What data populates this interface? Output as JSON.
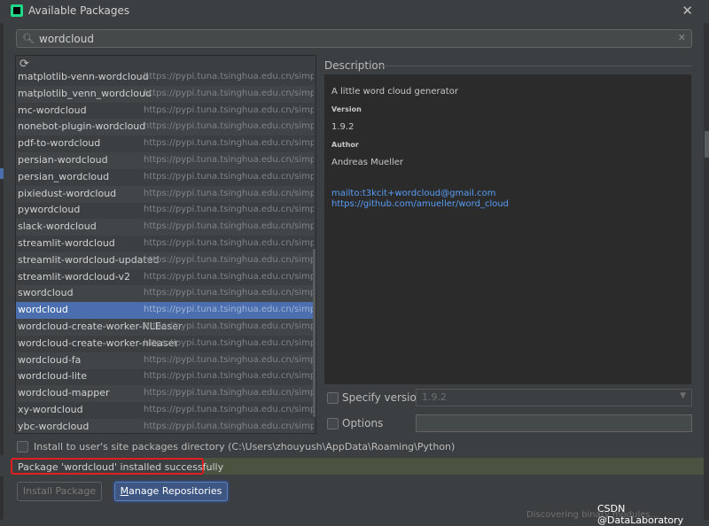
{
  "window": {
    "title": "Available Packages"
  },
  "search": {
    "value": "wordcloud"
  },
  "packages": [
    {
      "name": "matplotlib-venn-wordcloud",
      "repo": "https://pypi.tuna.tsinghua.edu.cn/simple/"
    },
    {
      "name": "matplotlib_venn_wordcloud",
      "repo": "https://pypi.tuna.tsinghua.edu.cn/simple/"
    },
    {
      "name": "mc-wordcloud",
      "repo": "https://pypi.tuna.tsinghua.edu.cn/simple/"
    },
    {
      "name": "nonebot-plugin-wordcloud",
      "repo": "https://pypi.tuna.tsinghua.edu.cn/simple/"
    },
    {
      "name": "pdf-to-wordcloud",
      "repo": "https://pypi.tuna.tsinghua.edu.cn/simple/"
    },
    {
      "name": "persian-wordcloud",
      "repo": "https://pypi.tuna.tsinghua.edu.cn/simple/"
    },
    {
      "name": "persian_wordcloud",
      "repo": "https://pypi.tuna.tsinghua.edu.cn/simple/"
    },
    {
      "name": "pixiedust-wordcloud",
      "repo": "https://pypi.tuna.tsinghua.edu.cn/simple/"
    },
    {
      "name": "pywordcloud",
      "repo": "https://pypi.tuna.tsinghua.edu.cn/simple/"
    },
    {
      "name": "slack-wordcloud",
      "repo": "https://pypi.tuna.tsinghua.edu.cn/simple/"
    },
    {
      "name": "streamlit-wordcloud",
      "repo": "https://pypi.tuna.tsinghua.edu.cn/simple/"
    },
    {
      "name": "streamlit-wordcloud-updated",
      "repo": "https://pypi.tuna.tsinghua.edu.cn/simple/"
    },
    {
      "name": "streamlit-wordcloud-v2",
      "repo": "https://pypi.tuna.tsinghua.edu.cn/simple/"
    },
    {
      "name": "swordcloud",
      "repo": "https://pypi.tuna.tsinghua.edu.cn/simple/"
    },
    {
      "name": "wordcloud",
      "repo": "https://pypi.tuna.tsinghua.edu.cn/simple/"
    },
    {
      "name": "wordcloud-create-worker-NLEaser",
      "repo": "https://pypi.tuna.tsinghua.edu.cn/simple/"
    },
    {
      "name": "wordcloud-create-worker-nleaser",
      "repo": "https://pypi.tuna.tsinghua.edu.cn/simple/"
    },
    {
      "name": "wordcloud-fa",
      "repo": "https://pypi.tuna.tsinghua.edu.cn/simple/"
    },
    {
      "name": "wordcloud-lite",
      "repo": "https://pypi.tuna.tsinghua.edu.cn/simple/"
    },
    {
      "name": "wordcloud-mapper",
      "repo": "https://pypi.tuna.tsinghua.edu.cn/simple/"
    },
    {
      "name": "xy-wordcloud",
      "repo": "https://pypi.tuna.tsinghua.edu.cn/simple/"
    },
    {
      "name": "ybc-wordcloud",
      "repo": "https://pypi.tuna.tsinghua.edu.cn/simple/"
    }
  ],
  "selected_package": "wordcloud",
  "description": {
    "header": "Description",
    "summary": "A little word cloud generator",
    "version_label": "Version",
    "version": "1.9.2",
    "author_label": "Author",
    "author": "Andreas Mueller",
    "email_link": "mailto:t3kcit+wordcloud@gmail.com",
    "url_link": "https://github.com/amueller/word_cloud"
  },
  "options": {
    "specify_version_label": "Specify version",
    "specify_version_value": "1.9.2",
    "options_label": "Options",
    "install_user_label": "Install to user's site packages directory (C:\\Users\\zhouyush\\AppData\\Roaming\\Python)"
  },
  "status": {
    "message": "Package 'wordcloud' installed successfully"
  },
  "buttons": {
    "install": "Install Package",
    "manage_prefix": "M",
    "manage_rest": "anage Repositories"
  },
  "watermark": "CSDN @DataLaboratory",
  "background_text": "Discovering binary modules...",
  "colors": {
    "selection": "#4b6eaf",
    "link": "#589df6",
    "status_highlight": "#e01f1f",
    "background": "#3c3f41"
  }
}
